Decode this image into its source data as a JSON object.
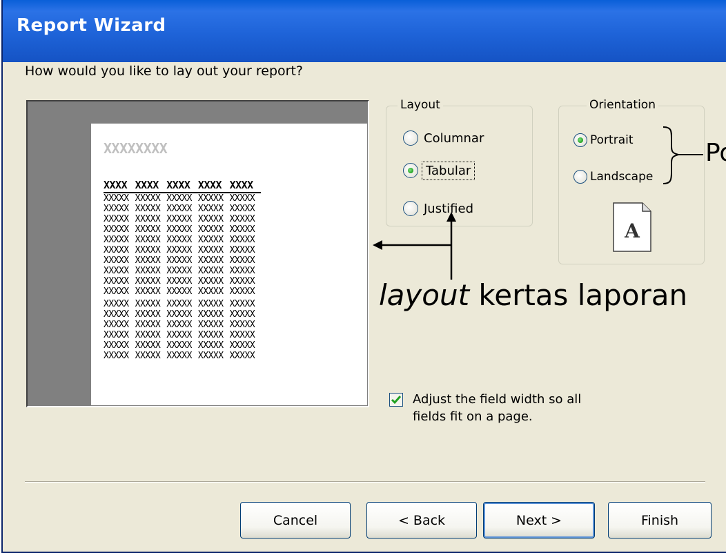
{
  "window": {
    "title": "Report Wizard"
  },
  "prompt": "How would you like to lay out your report?",
  "preview": {
    "title": "XXXXXXXX",
    "headers": [
      "XXXX",
      "XXXX",
      "XXXX",
      "XXXX",
      "XXXX"
    ],
    "cell": "XXXXX",
    "row_count": 16
  },
  "layout_group": {
    "label": "Layout",
    "options": [
      {
        "label": "Columnar",
        "selected": false
      },
      {
        "label": "Tabular",
        "selected": true
      },
      {
        "label": "Justified",
        "selected": false
      }
    ]
  },
  "orientation_group": {
    "label": "Orientation",
    "options": [
      {
        "label": "Portrait",
        "selected": true
      },
      {
        "label": "Landscape",
        "selected": false
      }
    ],
    "icon": "portrait-page-icon"
  },
  "annotations": {
    "orientation_note": "Po",
    "layout_note_italic": "layout",
    "layout_note_rest": " kertas laporan"
  },
  "adjust_checkbox": {
    "label": "Adjust the field width so all fields fit on a page.",
    "checked": true
  },
  "buttons": {
    "cancel": "Cancel",
    "back": "< Back",
    "next": "Next >",
    "finish": "Finish"
  },
  "colors": {
    "title_bar": "#1e63d8",
    "dialog_bg": "#ece9d8",
    "radio_dot": "#21a121",
    "check_mark": "#21a121"
  }
}
